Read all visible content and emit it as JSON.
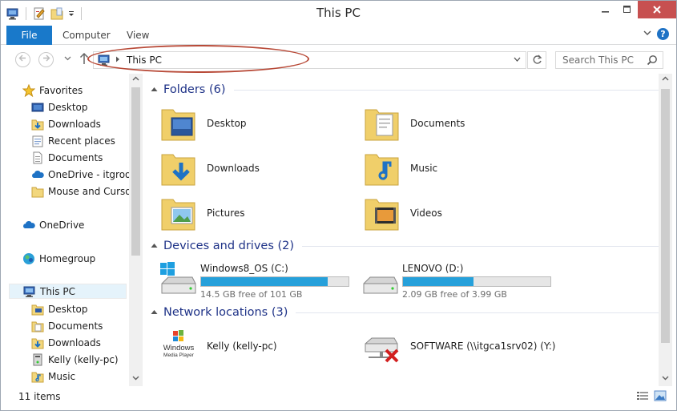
{
  "window": {
    "title": "This PC"
  },
  "ribbon": {
    "tabs": [
      "File",
      "Computer",
      "View"
    ],
    "help": "?"
  },
  "address": {
    "path": "This PC"
  },
  "search": {
    "placeholder": "Search This PC"
  },
  "nav": {
    "items": [
      {
        "label": "Favorites",
        "icon": "star-icon"
      },
      {
        "label": "Desktop",
        "icon": "desktop-icon"
      },
      {
        "label": "Downloads",
        "icon": "downloads-folder-icon"
      },
      {
        "label": "Recent places",
        "icon": "recent-places-icon"
      },
      {
        "label": "Documents",
        "icon": "documents-icon"
      },
      {
        "label": "OneDrive - itgroov",
        "icon": "onedrive-icon"
      },
      {
        "label": "Mouse and Cursor",
        "icon": "folder-icon"
      },
      {
        "label": "OneDrive",
        "icon": "onedrive-icon"
      },
      {
        "label": "Homegroup",
        "icon": "homegroup-icon"
      },
      {
        "label": "This PC",
        "icon": "computer-icon"
      },
      {
        "label": "Desktop",
        "icon": "desktop-folder-icon"
      },
      {
        "label": "Documents",
        "icon": "documents-folder-icon"
      },
      {
        "label": "Downloads",
        "icon": "downloads-folder-icon"
      },
      {
        "label": "Kelly (kelly-pc)",
        "icon": "network-computer-icon"
      },
      {
        "label": "Music",
        "icon": "music-folder-icon"
      }
    ]
  },
  "content": {
    "folders_header": "Folders (6)",
    "folders": [
      "Desktop",
      "Documents",
      "Downloads",
      "Music",
      "Pictures",
      "Videos"
    ],
    "devices_header": "Devices and drives (2)",
    "drives": [
      {
        "name": "Windows8_OS (C:)",
        "free": "14.5 GB free of 101 GB",
        "used_fraction": 0.856
      },
      {
        "name": "LENOVO (D:)",
        "free": "2.09 GB free of 3.99 GB",
        "used_fraction": 0.476
      }
    ],
    "network_header": "Network locations (3)",
    "network": [
      {
        "name": "Kelly (kelly-pc)",
        "icon": "windows-media-player-icon",
        "logo_text": "Windows\nMedia Player"
      },
      {
        "name": "SOFTWARE (\\\\itgca1srv02) (Y:)",
        "icon": "disconnected-network-drive-icon"
      }
    ]
  },
  "status": {
    "count": "11 items"
  },
  "colors": {
    "accent": "#1979ca",
    "header": "#1e3287",
    "drive_bar": "#26a0da",
    "annotation": "#b84a38"
  }
}
